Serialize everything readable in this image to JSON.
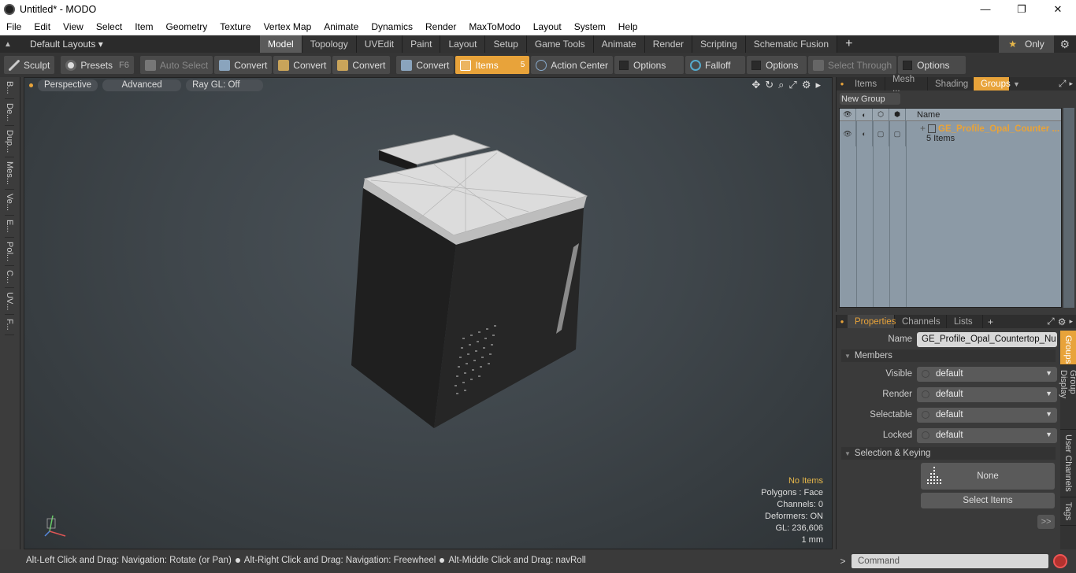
{
  "window": {
    "title": "Untitled* - MODO",
    "min": "—",
    "max": "❐",
    "close": "✕"
  },
  "menu": [
    "File",
    "Edit",
    "View",
    "Select",
    "Item",
    "Geometry",
    "Texture",
    "Vertex Map",
    "Animate",
    "Dynamics",
    "Render",
    "MaxToModo",
    "Layout",
    "System",
    "Help"
  ],
  "layoutbar": {
    "layouts_label": "Default Layouts ▾",
    "tabs": [
      "Model",
      "Topology",
      "UVEdit",
      "Paint",
      "Layout",
      "Setup",
      "Game Tools",
      "Animate",
      "Render",
      "Scripting",
      "Schematic Fusion"
    ],
    "active_tab": "Model",
    "only_label": "Only"
  },
  "toolbar": {
    "sculpt": "Sculpt",
    "presets": "Presets",
    "presets_key": "F6",
    "auto_select": "Auto Select",
    "convert1": "Convert",
    "convert2": "Convert",
    "convert3": "Convert",
    "convert4": "Convert",
    "items": "Items",
    "action_center": "Action Center",
    "options1": "Options",
    "falloff": "Falloff",
    "options2": "Options",
    "select_through": "Select Through",
    "options3": "Options"
  },
  "leftstrip": [
    "B...",
    "De...",
    "Dup...",
    "Mes...",
    "Ve...",
    "E...",
    "Pol...",
    "C...",
    "UV...",
    "F..."
  ],
  "viewport": {
    "perspective": "Perspective",
    "advanced": "Advanced",
    "raygl": "Ray GL: Off",
    "stats": {
      "no_items": "No Items",
      "polygons": "Polygons : Face",
      "channels": "Channels: 0",
      "deformers": "Deformers: ON",
      "gl": "GL: 236,606",
      "unit": "1 mm"
    }
  },
  "statusline": {
    "part1": "Alt-Left Click and Drag: Navigation: Rotate (or Pan)",
    "part2": "Alt-Right Click and Drag: Navigation: Freewheel",
    "part3": "Alt-Middle Click and Drag: navRoll"
  },
  "groups_panel": {
    "tabs": [
      "Items",
      "Mesh ...",
      "Shading",
      "Groups"
    ],
    "active_tab": "Groups",
    "new_group": "New Group",
    "col_name": "Name",
    "row": {
      "name": "GE_Profile_Opal_Counter ...",
      "count": "5 Items"
    }
  },
  "properties_panel": {
    "tabs": [
      "Properties",
      "Channels",
      "Lists"
    ],
    "active_tab": "Properties",
    "name_label": "Name",
    "name_value": "GE_Profile_Opal_Countertop_Nu",
    "members_section": "Members",
    "visible_label": "Visible",
    "visible_value": "default",
    "render_label": "Render",
    "render_value": "default",
    "selectable_label": "Selectable",
    "selectable_value": "default",
    "locked_label": "Locked",
    "locked_value": "default",
    "selection_section": "Selection & Keying",
    "none_label": "None",
    "select_items": "Select Items",
    "more": ">>"
  },
  "right_vtabs": [
    "Groups",
    "Group Display",
    "User Channels",
    "Tags"
  ],
  "command": {
    "prompt": ">",
    "placeholder": "Command"
  }
}
